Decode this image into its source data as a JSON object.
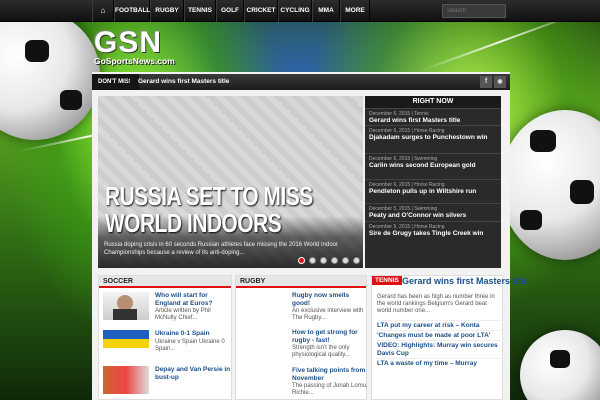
{
  "nav": {
    "home_icon": "home-icon",
    "items": [
      "FOOTBALL",
      "RUGBY",
      "TENNIS",
      "GOLF",
      "CRICKET",
      "CYCLING",
      "MMA",
      "MORE"
    ],
    "search_placeholder": "Search"
  },
  "logo": {
    "main": "GSN",
    "sub": "GoSportsNews.com"
  },
  "ticker": {
    "label": "DON'T MISS",
    "text": "Gerard wins first Masters title",
    "social": [
      "f",
      "rss"
    ]
  },
  "slider": {
    "title": "RUSSIA SET TO MISS WORLD INDOORS",
    "excerpt": "Russia doping crisis in 60 seconds Russian athletes face missing the 2016 World Indoor Championships because a review of its anti-doping...",
    "active_slide": 1,
    "slide_count": 6
  },
  "right_now": {
    "heading": "RIGHT NOW",
    "items": [
      {
        "meta": "December 6, 2015 | Tennis",
        "title": "Gerard wins first Masters title"
      },
      {
        "meta": "December 6, 2015 | Horse Racing",
        "title": "Djakadam surges to Punchestown win"
      },
      {
        "meta": "December 6, 2015 | Swimming",
        "title": "Carlin wins second European gold"
      },
      {
        "meta": "December 6, 2015 | Horse Racing",
        "title": "Pendleton pulls up in Wiltshire run"
      },
      {
        "meta": "December 5, 2015 | Swimming",
        "title": "Peaty and O'Connor win silvers"
      },
      {
        "meta": "December 5, 2015 | Horse Racing",
        "title": "Sire de Grugy takes Tingle Creek win"
      }
    ]
  },
  "soccer": {
    "heading": "SOCCER",
    "articles": [
      {
        "title": "Who will start for England at Euros?",
        "excerpt": "Article written by Phil McNulty Chief..."
      },
      {
        "title": "Ukraine 0-1 Spain",
        "excerpt": "Ukraine v Spain Ukraine 0 Spain..."
      },
      {
        "title": "Depay and Van Persie in bust-up",
        "excerpt": ""
      }
    ]
  },
  "rugby": {
    "heading": "RUGBY",
    "articles": [
      {
        "title": "Rugby now smells good!",
        "excerpt": "An exclusive interview with The Rugby..."
      },
      {
        "title": "How to get strong for rugby - fast!",
        "excerpt": "Strength isn't the only physiological quality..."
      },
      {
        "title": "Five talking points from November",
        "excerpt": "The passing of Jonah Lomu, Richie..."
      }
    ]
  },
  "tennis": {
    "badge": "TENNIS",
    "headline": "Gerard wins first Masters title",
    "excerpt": "Gerard has been as high as number three in the world rankings Belgium's Gerard beat world number one...",
    "links": [
      "LTA put my career at risk – Konta",
      "'Changes must be made at poor LTA'",
      "VIDEO: Highlights: Murray win secures Davis Cup",
      "LTA a waste of my time – Murray"
    ]
  },
  "colors": {
    "accent": "#dd1111",
    "link": "#1a4f8a",
    "nav": "#1b1b1b"
  }
}
